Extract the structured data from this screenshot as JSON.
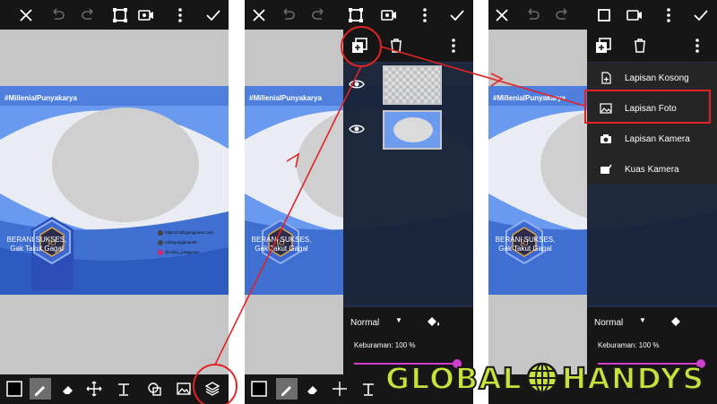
{
  "colors": {
    "accent_red": "#e32323",
    "slider": "#d43ad0",
    "watermark": "#c7e23a",
    "banner_blue": "#4f7fdc"
  },
  "icons": {
    "top": [
      "close-icon",
      "undo-icon",
      "redo-icon",
      "crop-icon",
      "video-icon",
      "more-icon",
      "check-icon"
    ],
    "bottom": [
      "color-swatch",
      "brush-icon",
      "eraser-icon",
      "move-icon",
      "text-icon",
      "shape-icon",
      "image-icon",
      "layers-icon"
    ]
  },
  "canvas": {
    "hashtag": "#MillenialPunyakarya",
    "tagline_line1": "BERANI SUKSES,",
    "tagline_line2": "Gak Takut Gagal",
    "contact_web": "https://robbyjungjunan.com",
    "contact_fb": "robbyjungjunan60",
    "contact_ig": "@robby_jungjunan",
    "logo_letters": "RJ"
  },
  "layers": {
    "blend_mode": "Normal",
    "opacity_label": "Keburaman: 100 %",
    "opacity_value": 100
  },
  "add_menu": {
    "items": [
      {
        "label": "Lapisan Kosong",
        "icon": "blank-file-icon"
      },
      {
        "label": "Lapisan Foto",
        "icon": "photo-icon"
      },
      {
        "label": "Lapisan Kamera",
        "icon": "camera-icon"
      },
      {
        "label": "Kuas Kamera",
        "icon": "camera-brush-icon"
      }
    ]
  },
  "watermark": {
    "left": "GLOBAL",
    "right": "HANDYS"
  }
}
